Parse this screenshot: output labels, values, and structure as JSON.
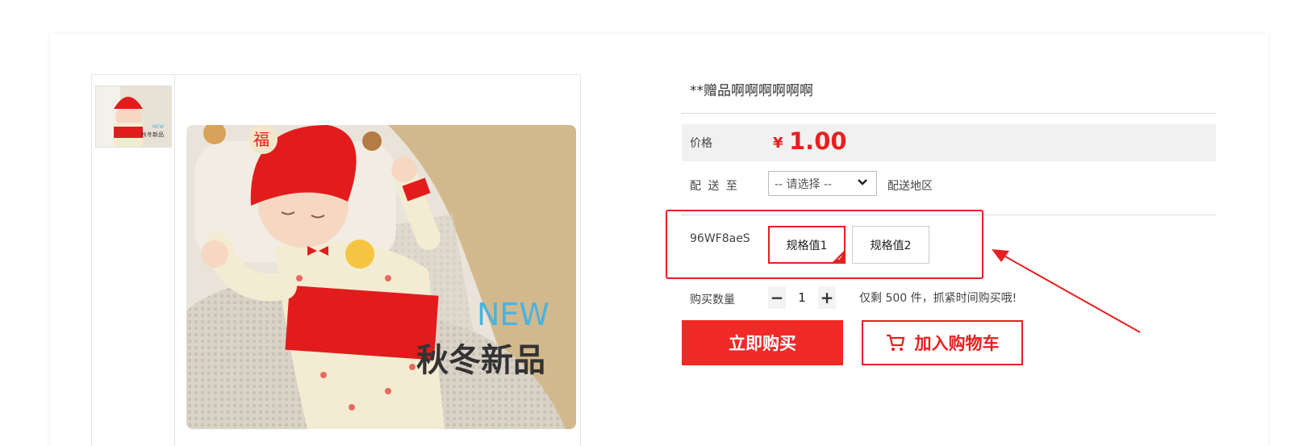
{
  "product": {
    "title": "**赠品啊啊啊啊啊啊",
    "price_label": "价格",
    "currency_symbol": "¥",
    "price": "1.00",
    "ship_label": "配 送 至",
    "ship_select_value": "-- 请选择 --",
    "ship_area_text": "配送地区",
    "spec_label": "96WF8aeS",
    "specs": [
      {
        "label": "规格值1",
        "selected": true
      },
      {
        "label": "规格值2",
        "selected": false
      }
    ],
    "qty_label": "购买数量",
    "qty_value": "1",
    "stock_text": "仅剩 500 件，抓紧时间购买哦!",
    "buy_label": "立即购买",
    "cart_label": "加入购物车"
  },
  "image": {
    "new_text": "NEW",
    "season_text": "秋冬新品",
    "hat_char": "福"
  },
  "colors": {
    "accent": "#e62020",
    "buy_bg": "#f02a27"
  }
}
